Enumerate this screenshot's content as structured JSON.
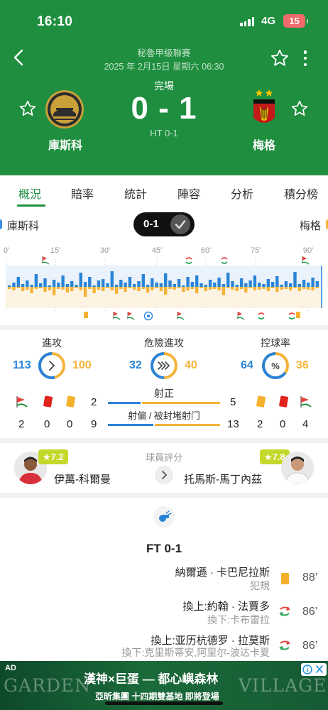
{
  "status_bar": {
    "time": "16:10",
    "network": "4G",
    "battery": "15"
  },
  "header": {
    "competition": "秘魯甲級聯賽",
    "datetime": "2025 年 2月15日 星期六 06:30",
    "match_status": "完場",
    "score": "0 - 1",
    "half_time": "HT 0-1",
    "home_team": "庫斯科",
    "away_team": "梅格",
    "home_logo_text": "CUSCO FUTBOL CLUB",
    "away_logo_text": "FBC MELGAR",
    "accent": "#1f8f3f"
  },
  "tabs": [
    {
      "label": "概況",
      "active": true
    },
    {
      "label": "賠率"
    },
    {
      "label": "統計"
    },
    {
      "label": "陣容"
    },
    {
      "label": "分析"
    },
    {
      "label": "積分榜"
    }
  ],
  "timeline": {
    "home_name": "庫斯科",
    "away_name": "梅格",
    "score": "0-1",
    "ticks": [
      "0'",
      "15'",
      "30'",
      "45'",
      "60'",
      "75'",
      "90'"
    ],
    "home_color": "#2a84d8",
    "away_color": "#f5b33a"
  },
  "stats": {
    "attack": {
      "label": "進攻",
      "home": "113",
      "away": "100"
    },
    "dangerous": {
      "label": "危險進攻",
      "home": "32",
      "away": "40"
    },
    "possession": {
      "label": "控球率",
      "home": "64",
      "away": "36"
    },
    "shots_on": {
      "label": "射正",
      "home": "2",
      "away": "5"
    },
    "shots_off": {
      "label": "射偏 / 被封堵射门",
      "home": "9",
      "away": "13"
    },
    "home_corners": "2",
    "home_red": "0",
    "home_yellow": "0",
    "away_yellow": "2",
    "away_red": "0",
    "away_corners": "4"
  },
  "rating": {
    "title": "球員評分",
    "home_player": "伊萬-科爾曼",
    "home_rating": "★7.2",
    "away_player": "托馬斯-馬丁內茲",
    "away_rating": "★7.8"
  },
  "events": {
    "ft_label": "FT 0-1",
    "items": [
      {
        "main": "納爾遜 · 卡巴尼拉斯",
        "sub": "犯規",
        "minute": "88’",
        "icon": "yellow-card-icon"
      },
      {
        "main": "換上:約翰 · 法賈多",
        "sub": "換下:卡布雷拉",
        "minute": "86’",
        "icon": "substitution-icon"
      },
      {
        "main": "換上:亚历杭德罗 · 拉莫斯",
        "sub": "換下:克里斯蒂安,阿里尔-波达卡夏",
        "minute": "86’",
        "icon": "substitution-icon"
      }
    ]
  },
  "ad": {
    "tag": "AD",
    "brand_left": "GARDEN",
    "brand_right": "VILLAGE",
    "title": "漢神×巨蛋 — 都心嶼森林",
    "subtitle": "亞昕集團 十四期雙基地 即將登場"
  }
}
